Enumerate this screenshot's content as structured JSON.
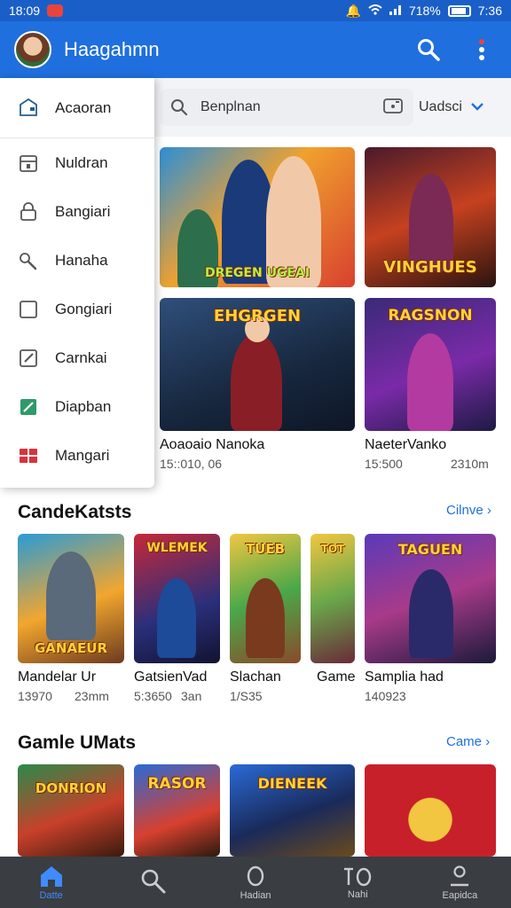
{
  "status": {
    "time": "18:09",
    "battery": "718%",
    "clock_right": "7:36"
  },
  "appbar": {
    "title": "Haagahmn"
  },
  "search": {
    "placeholder": "Benplnan",
    "filter_label": "Uadsci"
  },
  "drawer": {
    "items": [
      {
        "label": "Acaoran",
        "icon": "wallet-icon"
      },
      {
        "label": "Nuldran",
        "icon": "store-icon"
      },
      {
        "label": "Bangiari",
        "icon": "lock-icon"
      },
      {
        "label": "Hanaha",
        "icon": "link-icon"
      },
      {
        "label": "Gongiari",
        "icon": "square-icon"
      },
      {
        "label": "Carnkai",
        "icon": "edit-icon"
      },
      {
        "label": "Diapban",
        "icon": "chart-icon"
      },
      {
        "label": "Mangari",
        "icon": "grid-icon"
      }
    ]
  },
  "top_games": [
    {
      "logo": "DREGEN UGEAI",
      "title": "",
      "meta1": "",
      "meta2": ""
    },
    {
      "logo": "VINGHUES",
      "title": "",
      "meta1": "",
      "meta2": ""
    },
    {
      "logo": "EHGRGEN",
      "title": "Aoaoaio Nanoka",
      "meta1": "15::010, 06",
      "meta2": ""
    },
    {
      "logo": "RAGSNON",
      "title": "NaeterVanko",
      "meta1": "15:500",
      "meta2": "2310m"
    }
  ],
  "section1": {
    "title": "CandeKatsts",
    "more": "Cilnve",
    "games": [
      {
        "logo": "GANAEUR",
        "title": "Mandelar Ur",
        "meta1": "13970",
        "meta2": "23mm"
      },
      {
        "logo": "WLEMEK",
        "title": "GatsienVad",
        "meta1": "5:3650",
        "meta2": "3an"
      },
      {
        "logo": "TUEB",
        "title": "Slachan",
        "meta1": "1/S35",
        "meta2": ""
      },
      {
        "logo": "TOT",
        "title": "Game",
        "meta1": "",
        "meta2": ""
      },
      {
        "logo": "TAGUEN",
        "title": "Samplia had",
        "meta1": "140923",
        "meta2": ""
      }
    ]
  },
  "section2": {
    "title": "Gamle UMats",
    "more": "Came",
    "games": [
      {
        "logo": "DONRION"
      },
      {
        "logo": "RASOR"
      },
      {
        "logo": "DIENEEK"
      },
      {
        "logo": ""
      }
    ]
  },
  "bottom_nav": [
    {
      "label": "Datte",
      "icon": "home-icon"
    },
    {
      "label": "",
      "icon": "search-icon"
    },
    {
      "label": "Hadian",
      "icon": "circle-icon"
    },
    {
      "label": "Nahi",
      "icon": "versus-icon"
    },
    {
      "label": "Eapidca",
      "icon": "profile-icon"
    }
  ],
  "colors": {
    "primary": "#1f6fde",
    "status_bar": "#1a5fc7",
    "nav_bg": "#3a3d42"
  }
}
